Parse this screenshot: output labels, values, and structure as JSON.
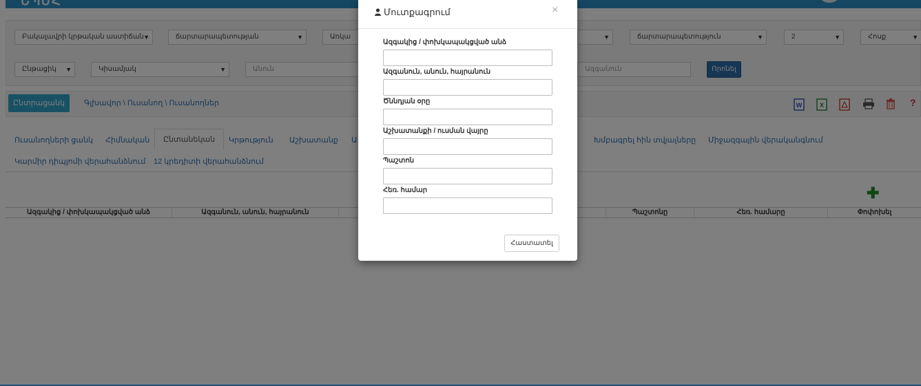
{
  "header": {
    "logo_text": "ԵՊՄՀ"
  },
  "filters": {
    "row1": [
      {
        "label": "Բակալավրի կրթական աստիճան"
      },
      {
        "label": "ճարտարապետության"
      },
      {
        "label": "Առկա"
      },
      {
        "label": "ճարտարապետություն"
      },
      {
        "label": "2"
      },
      {
        "label": "Հոսք"
      }
    ],
    "row2": {
      "status_select": "Ընթացիկ",
      "gender_select": "Կիսամյակ",
      "name_placeholder": "Անուն",
      "surname_placeholder": "Ազգանուն",
      "search_button": "Որոնել"
    }
  },
  "crumbbar": {
    "back_button": "Ընտրացանկ",
    "breadcrumb": "Գլխավոր \\ Ուսանող \\ Ուսանողներ",
    "help_icon_text": "?"
  },
  "tabs": {
    "items": [
      "Ուսանողների ցանկ",
      "Հիմնական",
      "Ընտանեկան",
      "Կրթություն",
      "Աշխատանք",
      "Ա",
      "Խմբագրել հին տվյալները",
      "Միջազգային վերականգնում",
      "Կարմիր դիպլոմի վերահանձնում",
      "12 կրեդիտի վերահանձնում"
    ],
    "active_index": 2
  },
  "table": {
    "headers": [
      "Ազգակից / փոխկապակցված անձ",
      "Ազգանուն, անուն, հայրանուն",
      "",
      "Պաշտոնը",
      "Հեռ. համարը",
      "Փոփոխել"
    ]
  },
  "modal": {
    "title": "Մուտքագրում",
    "close_symbol": "×",
    "fields": [
      {
        "label": "Ազգակից / փոխկապակցված անձ",
        "value": ""
      },
      {
        "label": "Ազգանուն, անուն, հայրանուն",
        "value": ""
      },
      {
        "label": "Ծննդյան օրը",
        "value": ""
      },
      {
        "label": "Աշխատանքի / ուսման վայրը",
        "value": ""
      },
      {
        "label": "Պաշտոն",
        "value": ""
      },
      {
        "label": "Հեռ. համար",
        "value": ""
      }
    ],
    "confirm_button": "Հաստատել"
  }
}
